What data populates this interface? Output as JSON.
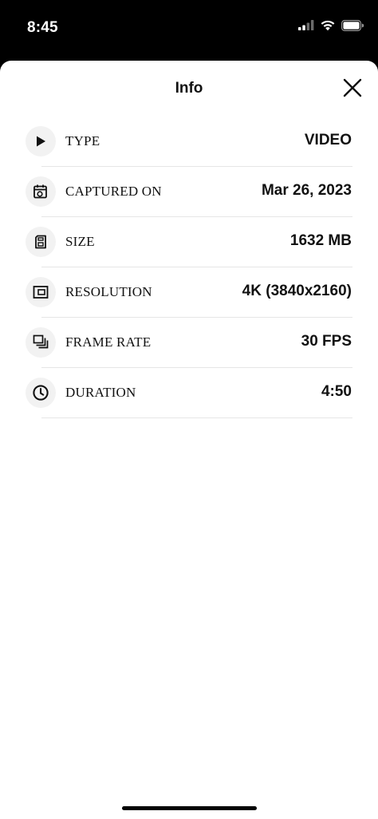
{
  "status_bar": {
    "time": "8:45",
    "icons": [
      "cellular-signal-icon",
      "wifi-icon",
      "battery-icon"
    ]
  },
  "sheet": {
    "title": "Info",
    "close_icon": "close-icon"
  },
  "rows": [
    {
      "icon": "play-icon",
      "label": "TYPE",
      "value": "VIDEO"
    },
    {
      "icon": "calendar-icon",
      "label": "CAPTURED ON",
      "value": "Mar 26, 2023"
    },
    {
      "icon": "sd-card-icon",
      "label": "SIZE",
      "value": "1632 MB"
    },
    {
      "icon": "resolution-icon",
      "label": "RESOLUTION",
      "value": "4K (3840x2160)"
    },
    {
      "icon": "frame-rate-icon",
      "label": "FRAME RATE",
      "value": "30 FPS"
    },
    {
      "icon": "clock-icon",
      "label": "DURATION",
      "value": "4:50"
    }
  ],
  "colors": {
    "background": "#000000",
    "sheet": "#ffffff",
    "text": "#111111",
    "icon_circle": "#f2f2f2",
    "divider": "#e6e6e6"
  }
}
